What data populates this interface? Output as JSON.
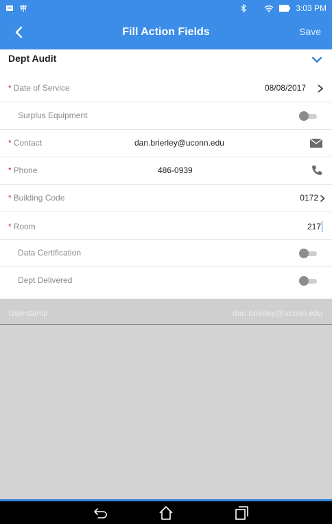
{
  "status_bar": {
    "time": "3:03 PM"
  },
  "app_bar": {
    "title": "Fill Action Fields",
    "save_label": "Save"
  },
  "section": {
    "title": "Dept Audit"
  },
  "fields": {
    "date_of_service": {
      "label": "Date of Service",
      "value": "08/08/2017",
      "required": true
    },
    "surplus_equipment": {
      "label": "Surplus Equipment",
      "on": false
    },
    "contact": {
      "label": "Contact",
      "value": "dan.brierley@uconn.edu",
      "required": true
    },
    "phone": {
      "label": "Phone",
      "value": "486-0939",
      "required": true
    },
    "building_code": {
      "label": "Building Code",
      "value": "0172",
      "required": true
    },
    "room": {
      "label": "Room",
      "value": "217",
      "required": true
    },
    "data_certification": {
      "label": "Data Certification",
      "on": false
    },
    "dept_delivered": {
      "label": "Dept Delivered",
      "on": false
    }
  },
  "userstamp": {
    "label": "Userstamp",
    "value": "dan.brierley@uconn.edu"
  },
  "required_marker": "*",
  "colors": {
    "primary": "#3b8de8",
    "required": "#c62828",
    "nav_bar": "#000000"
  },
  "icons": [
    "back-icon",
    "chevron-down-icon",
    "chevron-right-icon",
    "mail-icon",
    "phone-icon",
    "nav-back-icon",
    "nav-home-icon",
    "nav-recents-icon"
  ]
}
